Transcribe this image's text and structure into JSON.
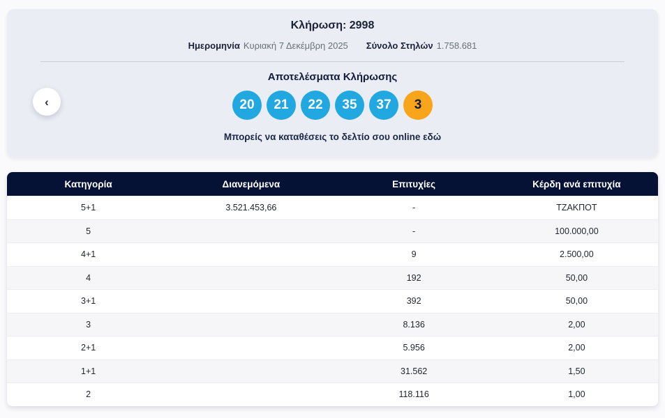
{
  "draw_card": {
    "title": "Κλήρωση: 2998",
    "date_label": "Ημερομηνία",
    "date_value": "Κυριακή 7 Δεκέμβρη 2025",
    "columns_label": "Σύνολο Στηλών",
    "columns_value": "1.758.681",
    "results_heading": "Αποτελέσματα Κλήρωσης",
    "numbers": [
      "20",
      "21",
      "22",
      "35",
      "37"
    ],
    "bonus_number": "3",
    "online_text": "Μπορείς να καταθέσεις το δελτίο σου online εδώ"
  },
  "nav": {
    "prev_icon": "‹"
  },
  "colors": {
    "number_ball": "#22a8e0",
    "bonus_ball": "#f9a51b",
    "table_header_bg": "#061136",
    "card_bg": "#eaedf3"
  },
  "table": {
    "headers": [
      "Κατηγορία",
      "Διανεμόμενα",
      "Επιτυχίες",
      "Κέρδη ανά επιτυχία"
    ],
    "rows": [
      {
        "category": "5+1",
        "distributed": "3.521.453,66",
        "winners": "-",
        "prize": "ΤΖΑΚΠΟΤ"
      },
      {
        "category": "5",
        "distributed": "",
        "winners": "-",
        "prize": "100.000,00"
      },
      {
        "category": "4+1",
        "distributed": "",
        "winners": "9",
        "prize": "2.500,00"
      },
      {
        "category": "4",
        "distributed": "",
        "winners": "192",
        "prize": "50,00"
      },
      {
        "category": "3+1",
        "distributed": "",
        "winners": "392",
        "prize": "50,00"
      },
      {
        "category": "3",
        "distributed": "",
        "winners": "8.136",
        "prize": "2,00"
      },
      {
        "category": "2+1",
        "distributed": "",
        "winners": "5.956",
        "prize": "2,00"
      },
      {
        "category": "1+1",
        "distributed": "",
        "winners": "31.562",
        "prize": "1,50"
      },
      {
        "category": "2",
        "distributed": "",
        "winners": "118.116",
        "prize": "1,00"
      }
    ]
  }
}
